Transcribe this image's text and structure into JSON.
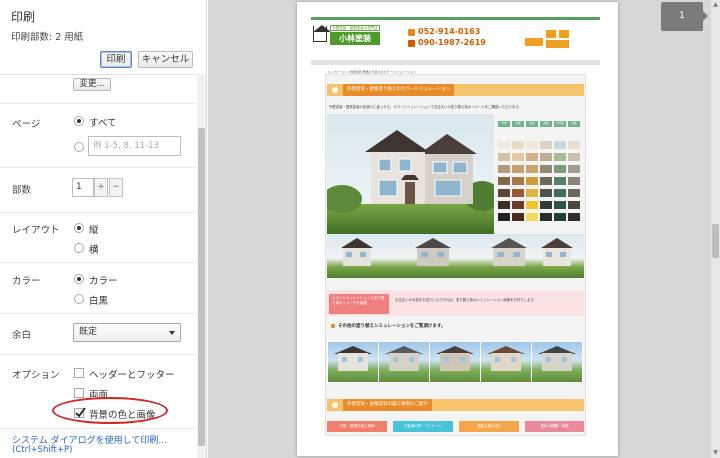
{
  "panel": {
    "title": "印刷",
    "sheets_text": "印刷部数: 2 用紙",
    "print_label": "印刷",
    "cancel_label": "キャンセル",
    "change_label": "変更...",
    "pages": {
      "label": "ページ",
      "all_label": "すべて",
      "range_placeholder": "例 1-5, 8, 11-13",
      "selected": "all"
    },
    "copies": {
      "label": "部数",
      "value": "1",
      "plus": "+",
      "minus": "−"
    },
    "layout": {
      "label": "レイアウト",
      "portrait": "縦",
      "landscape": "横",
      "selected": "portrait"
    },
    "color": {
      "label": "カラー",
      "color_option": "カラー",
      "bw_option": "白黒",
      "selected": "color"
    },
    "margins": {
      "label": "余白",
      "value": "既定"
    },
    "options": {
      "label": "オプション",
      "header_footer": "ヘッダーとフッター",
      "header_footer_checked": false,
      "duplex": "両面",
      "duplex_checked": false,
      "background": "背景の色と画像",
      "background_checked": true
    },
    "system_dialog_link": "システム ダイアログを使用して印刷...",
    "system_dialog_shortcut": "(Ctrl+Shift+P)"
  },
  "preview": {
    "page_number": "1",
    "site": {
      "logo_sub": "外壁塗装・屋根塗装の専門店",
      "logo_name": "小林塗装",
      "phone1": "052-914-0163",
      "phone2": "090-1987-2619",
      "breadcrumb": "トップページ > 外壁塗装 屋根塗り替えのカラーシミュレーション",
      "section1_title": "外壁塗装・屋根塗り替えのカラーシミュレーション",
      "section1_desc": "外壁塗装・屋根塗装の色選びに迷ったら、カラーシミュレーションでお住まいの塗り替え後のイメージをご確認いただけます。",
      "pink_box_text": "カラーシミュレーションで塗り替え後のイメージを確認",
      "pink_desc": "お住まいの写真をお送りいただければ、塗り替え後のシミュレーション画像をお作りします。",
      "section2_title": "その他の塗り替えシミュレーションをご覧頂けます。",
      "section3_title": "外壁塗装・屋根塗装の施工事例のご紹介",
      "link_buttons": [
        "外壁・屋根の施工事例",
        "お客様の声・アンケート",
        "塗装工事の流れ",
        "塗料の種類・特徴"
      ]
    },
    "swatch_colors": [
      "#f1eadb",
      "#e9ddc6",
      "#f0e6d2",
      "#d8d3c6",
      "#c8d9e5",
      "#e6e0cf",
      "#d4c3a6",
      "#e2c9a4",
      "#d4b089",
      "#b9ad92",
      "#a9b99a",
      "#c7c1b2",
      "#b59b7b",
      "#c4a071",
      "#c8a46a",
      "#8e8a74",
      "#7b9a77",
      "#a39d8e",
      "#85694f",
      "#a67a4a",
      "#d29b3a",
      "#6d6b5c",
      "#5a7d66",
      "#8a8476",
      "#5e4636",
      "#9a5a36",
      "#e0b440",
      "#4f5649",
      "#3f6a57",
      "#6c675c",
      "#3d2f28",
      "#6a3a2a",
      "#f3c42c",
      "#353b34",
      "#2d5546",
      "#4a4741",
      "#26201c",
      "#4d2a20",
      "#f6d95a",
      "#2a2e2a",
      "#204034",
      "#2f2d2a"
    ],
    "swatch_headers": [
      "外壁",
      "屋根",
      "破風",
      "雨樋",
      "付帯部",
      "玄関"
    ]
  }
}
